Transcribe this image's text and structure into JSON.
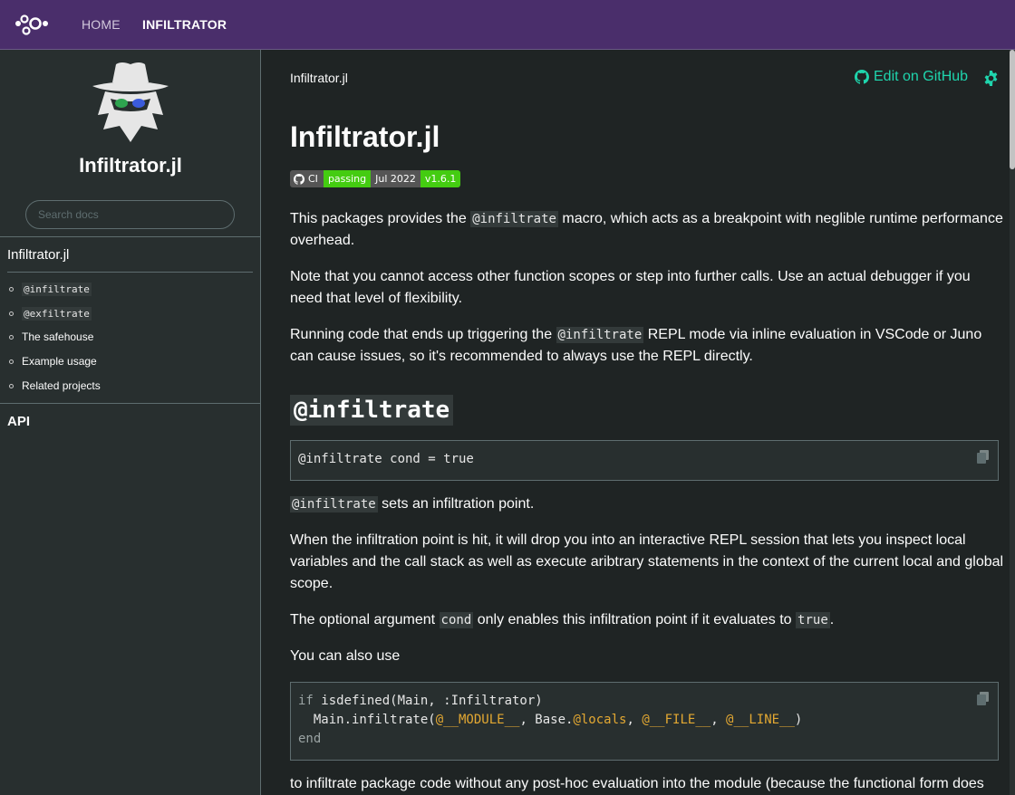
{
  "topbar": {
    "home_label": "HOME",
    "infiltrator_label": "INFILTRATOR"
  },
  "sidebar": {
    "site_title": "Infiltrator.jl",
    "search_placeholder": "Search docs",
    "toc_title": "Infiltrator.jl",
    "items": [
      {
        "label": "@infiltrate"
      },
      {
        "label": "@exfiltrate"
      },
      {
        "label": "The safehouse"
      },
      {
        "label": "Example usage"
      },
      {
        "label": "Related projects"
      }
    ],
    "api_label": "API"
  },
  "header": {
    "breadcrumb": "Infiltrator.jl",
    "edit_label": "Edit on GitHub"
  },
  "content": {
    "title": "Infiltrator.jl",
    "badges": {
      "ci": "CI",
      "status": "passing",
      "date": "Jul 2022",
      "version": "v1.6.1"
    },
    "p1_pre": "This packages provides the ",
    "p1_code": "@infiltrate",
    "p1_post": " macro, which acts as a breakpoint with neglible runtime performance overhead.",
    "p2": "Note that you cannot access other function scopes or step into further calls. Use an actual debugger if you need that level of flexibility.",
    "p3_pre": "Running code that ends up triggering the ",
    "p3_code": "@infiltrate",
    "p3_post": " REPL mode via inline evaluation in VSCode or Juno can cause issues, so it's recommended to always use the REPL directly.",
    "h2": "@infiltrate",
    "code1": "@infiltrate cond = true",
    "p4_code": "@infiltrate",
    "p4_post": " sets an infiltration point.",
    "p5": "When the infiltration point is hit, it will drop you into an interactive REPL session that lets you inspect local variables and the call stack as well as execute aribtrary statements in the context of the current local and global scope.",
    "p6_pre": "The optional argument ",
    "p6_code": "cond",
    "p6_mid": " only enables this infiltration point if it evaluates to ",
    "p6_code2": "true",
    "p6_post": ".",
    "p7": "You can also use",
    "code2": {
      "l1_kw": "if",
      "l1_rest": " isdefined(Main, :Infiltrator)",
      "l2_a": "  Main.infiltrate(",
      "l2_m1": "@__MODULE__",
      "l2_b": ", Base.",
      "l2_m2": "@locals",
      "l2_c": ", ",
      "l2_m3": "@__FILE__",
      "l2_d": ", ",
      "l2_m4": "@__LINE__",
      "l2_e": ")",
      "l3": "end"
    },
    "p8": "to infiltrate package code without any post-hoc evaluation into the module (because the functional form does"
  },
  "colors": {
    "topbar": "#4a2e6b",
    "sidebar": "#282f2f",
    "body": "#1f2424",
    "link": "#1fd5ad",
    "macro": "#e3a832"
  },
  "icons": [
    "julia-logo-icon",
    "spy-mascot-icon",
    "github-icon",
    "gear-icon",
    "copy-icon"
  ]
}
